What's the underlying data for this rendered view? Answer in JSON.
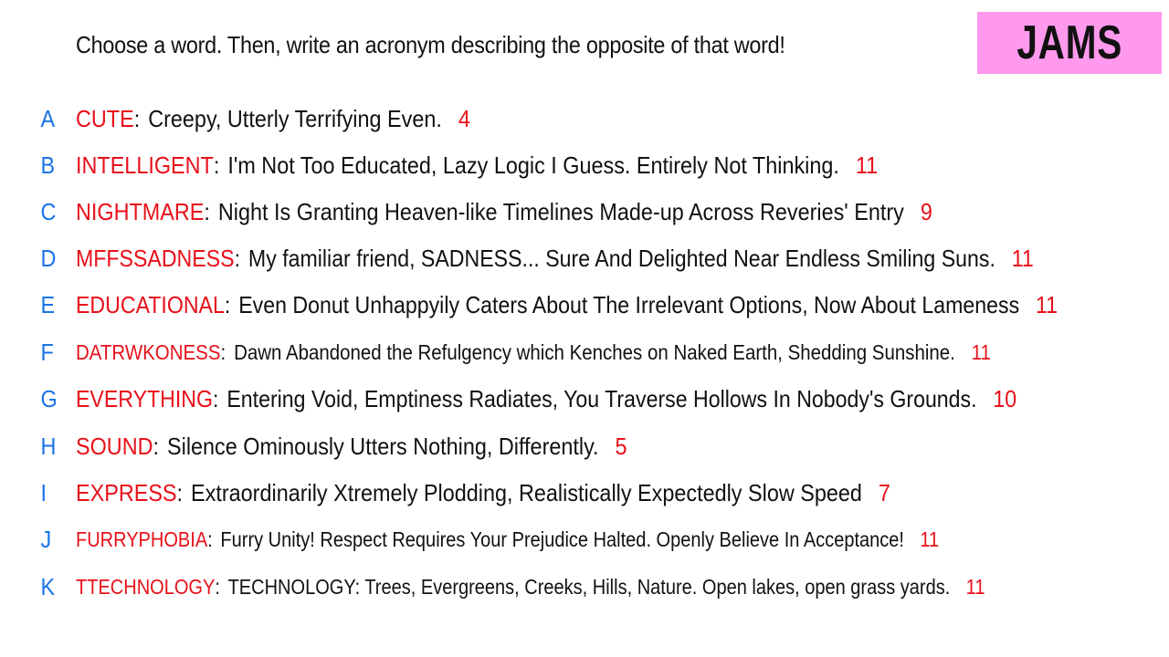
{
  "prompt": "Choose a word. Then, write an acronym describing the opposite of that word!",
  "badge": {
    "label": "JAMS",
    "background": "#ff99ee"
  },
  "colors": {
    "letter": "#1a73e8",
    "word": "#e8101a",
    "count": "#e8101a",
    "text": "#111111"
  },
  "entries": [
    {
      "letter": "A",
      "word": "CUTE",
      "acronym": "Creepy, Utterly Terrifying Even.",
      "count": "4"
    },
    {
      "letter": "B",
      "word": "INTELLIGENT",
      "acronym": "I'm Not Too Educated, Lazy Logic I Guess. Entirely Not Thinking.",
      "count": "11"
    },
    {
      "letter": "C",
      "word": "NIGHTMARE",
      "acronym": "Night Is Granting Heaven-like Timelines Made-up Across Reveries' Entry",
      "count": "9"
    },
    {
      "letter": "D",
      "word": "MFFSSADNESS",
      "acronym": "My familiar friend, SADNESS... Sure And Delighted Near Endless Smiling Suns.",
      "count": "11"
    },
    {
      "letter": "E",
      "word": "EDUCATIONAL",
      "acronym": "Even Donut Unhappyily Caters About The Irrelevant Options, Now About Lameness",
      "count": "11"
    },
    {
      "letter": "F",
      "word": "DATRWKONESS",
      "acronym": "Dawn Abandoned the Refulgency which Kenches on Naked Earth, Shedding Sunshine.",
      "count": "11"
    },
    {
      "letter": "G",
      "word": "EVERYTHING",
      "acronym": "Entering Void, Emptiness Radiates, You Traverse Hollows In Nobody's Grounds.",
      "count": "10"
    },
    {
      "letter": "H",
      "word": "SOUND",
      "acronym": "Silence Ominously Utters Nothing, Differently.",
      "count": "5"
    },
    {
      "letter": "I",
      "word": "EXPRESS",
      "acronym": "Extraordinarily Xtremely Plodding, Realistically Expectedly Slow Speed",
      "count": "7"
    },
    {
      "letter": "J",
      "word": "FURRYPHOBIA",
      "acronym": "Furry Unity! Respect Requires Your Prejudice Halted. Openly Believe In Acceptance!",
      "count": "11"
    },
    {
      "letter": "K",
      "word": "TTECHNOLOGY",
      "acronym": "TECHNOLOGY: Trees, Evergreens, Creeks, Hills, Nature. Open lakes, open grass yards.",
      "count": "11"
    }
  ]
}
